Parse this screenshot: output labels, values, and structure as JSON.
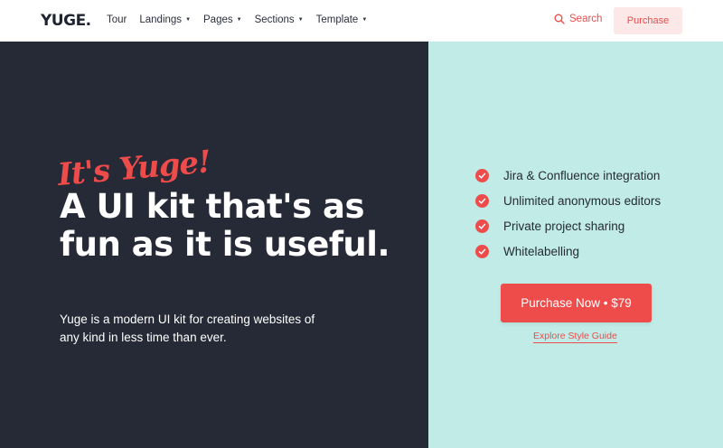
{
  "nav": {
    "logo": "YUGE.",
    "links": [
      {
        "label": "Tour",
        "dropdown": false
      },
      {
        "label": "Landings",
        "dropdown": true
      },
      {
        "label": "Pages",
        "dropdown": true
      },
      {
        "label": "Sections",
        "dropdown": true
      },
      {
        "label": "Template",
        "dropdown": true
      }
    ],
    "search_label": "Search",
    "purchase_label": "Purchase"
  },
  "hero": {
    "tagline": "It's Yuge!",
    "headline": "A UI kit that's as fun as it is useful.",
    "subtext": "Yuge is a modern UI kit for creating websites of any kind in less time than ever.",
    "features": [
      "Jira & Confluence integration",
      "Unlimited anonymous editors",
      "Private project sharing",
      "Whitelabelling"
    ],
    "cta_label": "Purchase Now • $79",
    "explore_label": "Explore Style Guide"
  },
  "colors": {
    "accent": "#ee4b4b",
    "dark_panel": "#262a36",
    "mint_panel": "#c0ebe6",
    "purchase_bg": "#fde8e8"
  }
}
